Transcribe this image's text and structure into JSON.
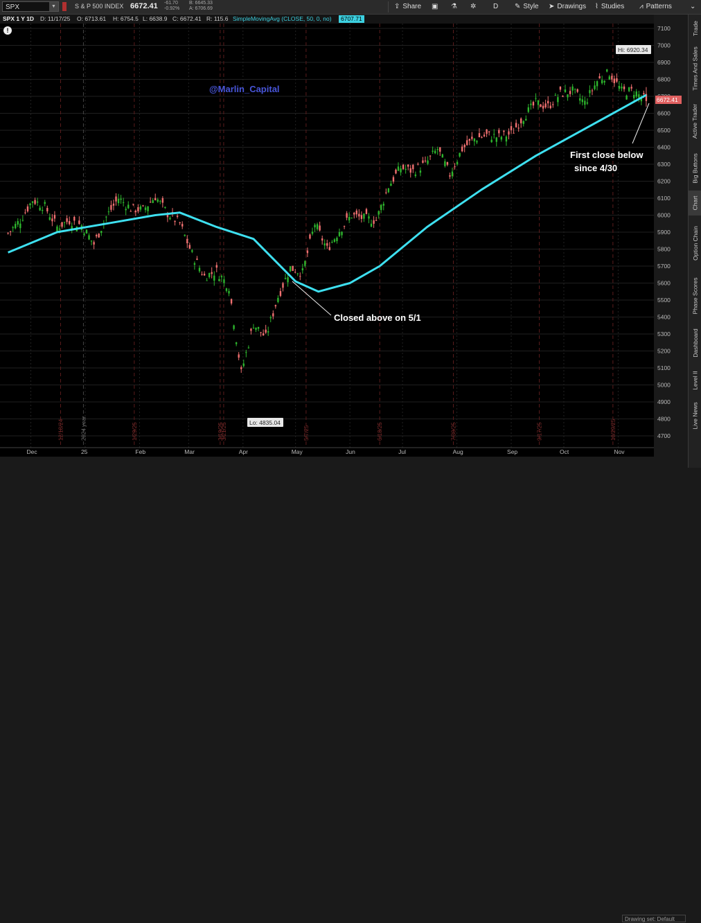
{
  "toolbar": {
    "symbol": "SPX",
    "symbol_name": "S & P 500 INDEX",
    "price": "6672.41",
    "change": "-61.70",
    "change_pct": "-0.92%",
    "bid": "B: 6645.33",
    "ask": "A: 6706.69",
    "share_label": "Share",
    "aggregation": "D",
    "style_label": "Style",
    "drawings_label": "Drawings",
    "studies_label": "Studies",
    "patterns_label": "Patterns"
  },
  "info_bar": {
    "title": "SPX 1 Y 1D",
    "date": "D: 11/17/25",
    "open": "O: 6713.61",
    "high": "H: 6754.5",
    "low": "L: 6638.9",
    "close": "C: 6672.41",
    "range": "R: 115.6",
    "study": "SimpleMovingAvg (CLOSE, 50, 0, no)",
    "study_value": "6707.71"
  },
  "right_tabs": [
    "Trade",
    "Times And Sales",
    "Active Trader",
    "Big Buttons",
    "Chart",
    "Option Chain",
    "Phase Scores",
    "Dashboard",
    "Level II",
    "Live News"
  ],
  "drawing_set": "Drawing set: Default",
  "chart_data": {
    "type": "candlestick",
    "symbol": "SPX",
    "timeframe": "1 Y 1D",
    "ylim": [
      4650,
      7120
    ],
    "yticks": [
      4700,
      4800,
      4900,
      5000,
      5100,
      5200,
      5300,
      5400,
      5500,
      5600,
      5700,
      5800,
      5900,
      6000,
      6100,
      6200,
      6300,
      6400,
      6500,
      6600,
      6700,
      6800,
      6900,
      7000,
      7100
    ],
    "xlabels": [
      "Dec",
      "25",
      "Feb",
      "Mar",
      "Apr",
      "May",
      "Jun",
      "Jul",
      "Aug",
      "Sep",
      "Oct",
      "Nov"
    ],
    "vertical_markers": [
      "12/18/24",
      "2024 year",
      "1/29/25",
      "3/19/25",
      "3/21/25",
      "5/7/25",
      "6/18/25",
      "7/30/25",
      "9/17/25",
      "10/29/25"
    ],
    "close_series": [
      {
        "date": "2024-11-18",
        "close": 5893
      },
      {
        "date": "2024-11-25",
        "close": 5970
      },
      {
        "date": "2024-12-02",
        "close": 6090
      },
      {
        "date": "2024-12-09",
        "close": 6050
      },
      {
        "date": "2024-12-16",
        "close": 5930
      },
      {
        "date": "2024-12-23",
        "close": 5970
      },
      {
        "date": "2024-12-30",
        "close": 5940
      },
      {
        "date": "2025-01-06",
        "close": 5830
      },
      {
        "date": "2025-01-13",
        "close": 5990
      },
      {
        "date": "2025-01-20",
        "close": 6100
      },
      {
        "date": "2025-01-27",
        "close": 6040
      },
      {
        "date": "2025-02-03",
        "close": 6030
      },
      {
        "date": "2025-02-10",
        "close": 6110
      },
      {
        "date": "2025-02-17",
        "close": 6010
      },
      {
        "date": "2025-02-24",
        "close": 5950
      },
      {
        "date": "2025-03-03",
        "close": 5770
      },
      {
        "date": "2025-03-10",
        "close": 5640
      },
      {
        "date": "2025-03-17",
        "close": 5670
      },
      {
        "date": "2025-03-24",
        "close": 5580
      },
      {
        "date": "2025-03-31",
        "close": 5070
      },
      {
        "date": "2025-04-07",
        "close": 5360
      },
      {
        "date": "2025-04-14",
        "close": 5280
      },
      {
        "date": "2025-04-21",
        "close": 5520
      },
      {
        "date": "2025-04-28",
        "close": 5690
      },
      {
        "date": "2025-05-05",
        "close": 5660
      },
      {
        "date": "2025-05-12",
        "close": 5950
      },
      {
        "date": "2025-05-19",
        "close": 5800
      },
      {
        "date": "2025-05-26",
        "close": 5910
      },
      {
        "date": "2025-06-02",
        "close": 6000
      },
      {
        "date": "2025-06-09",
        "close": 5980
      },
      {
        "date": "2025-06-16",
        "close": 5970
      },
      {
        "date": "2025-06-23",
        "close": 6170
      },
      {
        "date": "2025-06-30",
        "close": 6280
      },
      {
        "date": "2025-07-07",
        "close": 6260
      },
      {
        "date": "2025-07-14",
        "close": 6300
      },
      {
        "date": "2025-07-21",
        "close": 6390
      },
      {
        "date": "2025-07-28",
        "close": 6240
      },
      {
        "date": "2025-08-04",
        "close": 6390
      },
      {
        "date": "2025-08-11",
        "close": 6450
      },
      {
        "date": "2025-08-18",
        "close": 6470
      },
      {
        "date": "2025-08-25",
        "close": 6460
      },
      {
        "date": "2025-09-01",
        "close": 6480
      },
      {
        "date": "2025-09-08",
        "close": 6580
      },
      {
        "date": "2025-09-15",
        "close": 6660
      },
      {
        "date": "2025-09-22",
        "close": 6640
      },
      {
        "date": "2025-09-29",
        "close": 6715
      },
      {
        "date": "2025-10-06",
        "close": 6730
      },
      {
        "date": "2025-10-13",
        "close": 6660
      },
      {
        "date": "2025-10-20",
        "close": 6790
      },
      {
        "date": "2025-10-27",
        "close": 6840
      },
      {
        "date": "2025-11-03",
        "close": 6730
      },
      {
        "date": "2025-11-10",
        "close": 6730
      },
      {
        "date": "2025-11-17",
        "close": 6672.41
      }
    ],
    "sma50_series": [
      {
        "date": "2024-11-18",
        "value": 5780
      },
      {
        "date": "2024-12-16",
        "value": 5900
      },
      {
        "date": "2025-01-13",
        "value": 5950
      },
      {
        "date": "2025-02-10",
        "value": 6000
      },
      {
        "date": "2025-02-24",
        "value": 6015
      },
      {
        "date": "2025-03-17",
        "value": 5930
      },
      {
        "date": "2025-04-07",
        "value": 5860
      },
      {
        "date": "2025-05-01",
        "value": 5610
      },
      {
        "date": "2025-05-14",
        "value": 5550
      },
      {
        "date": "2025-06-01",
        "value": 5600
      },
      {
        "date": "2025-06-18",
        "value": 5700
      },
      {
        "date": "2025-07-15",
        "value": 5930
      },
      {
        "date": "2025-08-15",
        "value": 6150
      },
      {
        "date": "2025-09-15",
        "value": 6350
      },
      {
        "date": "2025-10-15",
        "value": 6520
      },
      {
        "date": "2025-11-17",
        "value": 6707.71
      }
    ],
    "annotations": {
      "watermark": "@Marlin_Capital",
      "high": "Hi: 6920.34",
      "low": "Lo: 4835.04",
      "last_price": "6672.41",
      "note_above": "Closed above on 5/1",
      "note_below_1": "First close below",
      "note_below_2": "since 4/30"
    },
    "colors": {
      "up": "#2db52d",
      "down": "#f07070",
      "sma": "#3ee0f0",
      "marker": "#8a2020",
      "bg": "#000000"
    }
  }
}
